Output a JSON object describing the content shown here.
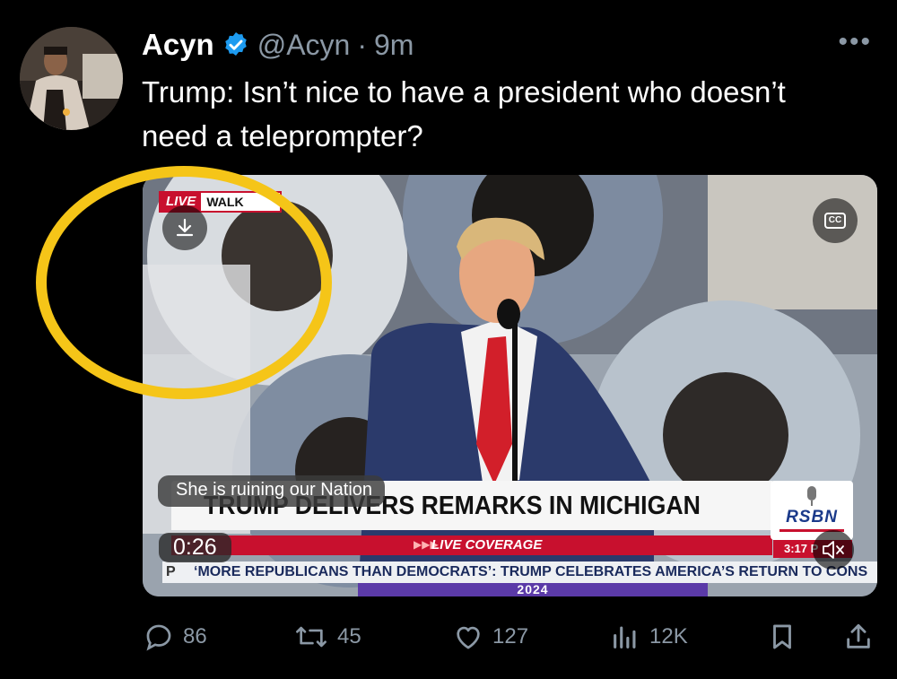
{
  "author": {
    "name": "Acyn",
    "handle": "@Acyn",
    "separator": "·",
    "time": "9m",
    "verified_color": "#1d9bf0"
  },
  "more_icon": "more-horizontal-icon",
  "tweet": {
    "text": "Trump: Isn’t nice to have a president who doesn’t need a teleprompter?"
  },
  "video": {
    "live_label": "LIVE",
    "location_label": "WALK",
    "chyron": "TRUMP DELIVERS REMARKS IN MICHIGAN",
    "live_coverage": "LIVE COVERAGE",
    "network": "RSBN",
    "clock": "3:17 P",
    "ticker": "‘MORE REPUBLICANS THAN DEMOCRATS’: TRUMP CELEBRATES AMERICA’S RETURN TO CONS",
    "ticker_prefix": "P",
    "banner_year": "2024",
    "caption": "She is ruining our Nation",
    "elapsed": "0:26",
    "cc_label": "CC"
  },
  "actions": {
    "replies": "86",
    "reposts": "45",
    "likes": "127",
    "views": "12K"
  },
  "colors": {
    "background": "#000000",
    "muted_text": "#8b98a5",
    "highlight_circle": "#f5c518",
    "news_red": "#c8102e"
  }
}
